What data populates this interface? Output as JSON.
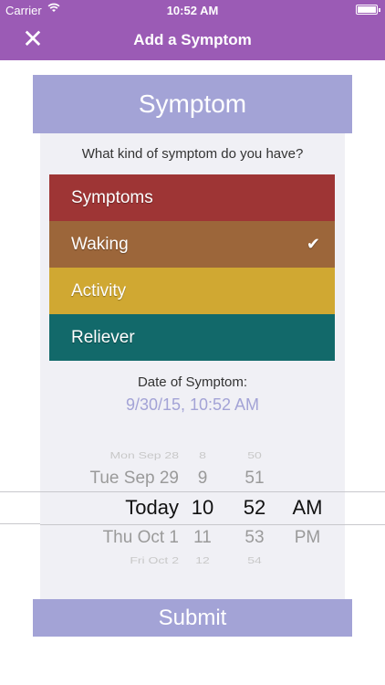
{
  "status_bar": {
    "carrier": "Carrier",
    "wifi_icon": "wifi-icon",
    "time": "10:52 AM",
    "battery_icon": "battery-icon"
  },
  "nav": {
    "title": "Add a Symptom",
    "close_icon": "close-icon",
    "close_glyph": "✕"
  },
  "colors": {
    "nav": "#9b5bb5",
    "accent": "#a3a3d6",
    "panel": "#f0f0f5"
  },
  "form": {
    "header": "Symptom",
    "question": "What kind of symptom do you have?",
    "options": [
      {
        "label": "Symptoms",
        "color": "#9e3535",
        "selected": false
      },
      {
        "label": "Waking",
        "color": "#9c663a",
        "selected": true
      },
      {
        "label": "Activity",
        "color": "#d0a832",
        "selected": false
      },
      {
        "label": "Reliever",
        "color": "#12696a",
        "selected": false
      }
    ],
    "check_glyph": "✔",
    "date_label": "Date of Symptom:",
    "date_value": "9/30/15, 10:52 AM",
    "submit_label": "Submit"
  },
  "picker": {
    "day": [
      "Mon Sep 28",
      "Tue Sep 29",
      "Today",
      "Thu Oct 1",
      "Fri Oct 2"
    ],
    "hour": [
      "8",
      "9",
      "10",
      "11",
      "12"
    ],
    "minute": [
      "50",
      "51",
      "52",
      "53",
      "54"
    ],
    "ampm": [
      "",
      "",
      "AM",
      "PM",
      ""
    ]
  }
}
